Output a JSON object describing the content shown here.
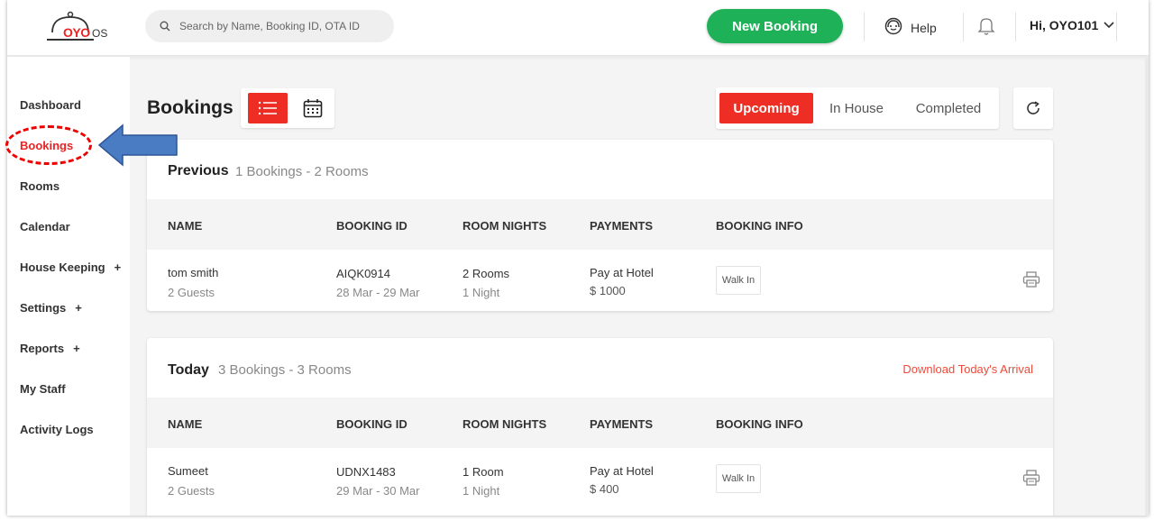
{
  "header": {
    "logo_brand": "OYO",
    "logo_os": "OS",
    "search_placeholder": "Search by Name, Booking ID, OTA ID",
    "new_booking": "New Booking",
    "help": "Help",
    "user": "Hi, OYO101"
  },
  "sidebar": {
    "items": [
      {
        "label": "Dashboard",
        "plus": ""
      },
      {
        "label": "Bookings",
        "plus": ""
      },
      {
        "label": "Rooms",
        "plus": ""
      },
      {
        "label": "Calendar",
        "plus": ""
      },
      {
        "label": "House Keeping",
        "plus": "+"
      },
      {
        "label": "Settings",
        "plus": "+"
      },
      {
        "label": "Reports",
        "plus": "+"
      },
      {
        "label": "My Staff",
        "plus": ""
      },
      {
        "label": "Activity Logs",
        "plus": ""
      }
    ],
    "active": "Bookings"
  },
  "main": {
    "title": "Bookings",
    "tabs": [
      "Upcoming",
      "In House",
      "Completed"
    ],
    "active_tab": "Upcoming",
    "columns": [
      "NAME",
      "BOOKING ID",
      "ROOM NIGHTS",
      "PAYMENTS",
      "BOOKING INFO"
    ],
    "sections": [
      {
        "title": "Previous",
        "summary": "1 Bookings - 2 Rooms",
        "action": "",
        "rows": [
          {
            "name": "tom smith",
            "guests": "2 Guests",
            "booking_id": "AIQK0914",
            "dates": "28 Mar - 29 Mar",
            "rooms": "2 Rooms",
            "nights": "1 Night",
            "payment": "Pay at Hotel",
            "amount": "$ 1000",
            "info": "Walk In"
          }
        ]
      },
      {
        "title": "Today",
        "summary": "3 Bookings - 3 Rooms",
        "action": "Download Today's Arrival",
        "rows": [
          {
            "name": "Sumeet",
            "guests": "2 Guests",
            "booking_id": "UDNX1483",
            "dates": "29 Mar - 30 Mar",
            "rooms": "1 Room",
            "nights": "1 Night",
            "payment": "Pay at Hotel",
            "amount": "$ 400",
            "info": "Walk In"
          }
        ]
      }
    ]
  },
  "colors": {
    "accent": "#ee2e24",
    "green": "#1fb157",
    "annotation_arrow": "#4a7cc4"
  }
}
